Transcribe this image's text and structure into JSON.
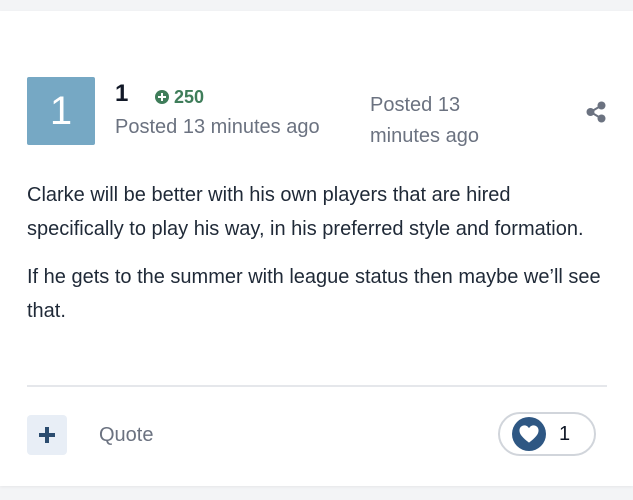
{
  "colors": {
    "avatar_bg": "#76a8c4",
    "reputation": "#3f7d5a",
    "accent_dark": "#2b4c6f",
    "heart_bg": "#2e5783"
  },
  "author": {
    "avatar_letter": "1",
    "name": "1",
    "reputation": "250",
    "reputation_icon": "plus-circle-icon",
    "posted": "Posted 13 minutes ago"
  },
  "post_meta": {
    "posted": "Posted 13 minutes ago",
    "share_icon": "share-icon"
  },
  "post": {
    "paragraphs": [
      "Clarke will be better with his own players that are hired specifically to play his way, in his preferred style and formation.",
      "If he gets to the summer with league status then maybe we’ll see that."
    ]
  },
  "footer": {
    "plus_icon": "plus-icon",
    "quote_label": "Quote",
    "reaction_icon": "heart-icon",
    "reaction_count": "1"
  }
}
